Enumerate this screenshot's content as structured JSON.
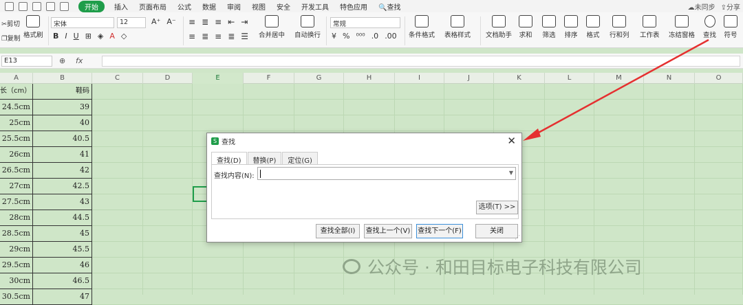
{
  "menubar": {
    "tabs": [
      "开始",
      "插入",
      "页面布局",
      "公式",
      "数据",
      "审阅",
      "视图",
      "安全",
      "开发工具",
      "特色应用"
    ],
    "active_tab": "开始",
    "search": "查找",
    "sync": "未同步",
    "share": "分享"
  },
  "ribbon": {
    "cut": "剪切",
    "copy": "复制",
    "format_painter": "格式刷",
    "font_name": "宋体",
    "font_size": "12",
    "merge_center": "合并居中",
    "wrap_text": "自动换行",
    "number_format": "常规",
    "conditional_format": "条件格式",
    "table_style": "表格样式",
    "doc_assistant": "文档助手",
    "sum": "求和",
    "filter": "筛选",
    "sort": "排序",
    "format": "格式",
    "rows_cols": "行和列",
    "worksheet": "工作表",
    "freeze": "冻结窗格",
    "find": "查找",
    "symbol": "符号"
  },
  "formula_bar": {
    "cell_ref": "E13",
    "fx": "fx"
  },
  "columns": [
    "A",
    "B",
    "C",
    "D",
    "E",
    "F",
    "G",
    "H",
    "I",
    "J",
    "K",
    "L",
    "M",
    "N",
    "O"
  ],
  "sheet": {
    "header": [
      "长（cm）",
      "鞋码"
    ],
    "rows": [
      [
        "24.5cm",
        "39"
      ],
      [
        "25cm",
        "40"
      ],
      [
        "25.5cm",
        "40.5"
      ],
      [
        "26cm",
        "41"
      ],
      [
        "26.5cm",
        "42"
      ],
      [
        "27cm",
        "42.5"
      ],
      [
        "27.5cm",
        "43"
      ],
      [
        "28cm",
        "44.5"
      ],
      [
        "28.5cm",
        "45"
      ],
      [
        "29cm",
        "45.5"
      ],
      [
        "29.5cm",
        "46"
      ],
      [
        "30cm",
        "46.5"
      ],
      [
        "30.5cm",
        "47"
      ]
    ]
  },
  "dialog": {
    "title": "查找",
    "tabs": [
      "查找(D)",
      "替换(P)",
      "定位(G)"
    ],
    "find_label": "查找内容(N):",
    "find_value": "",
    "options": "选项(T) >>",
    "buttons": [
      "查找全部(I)",
      "查找上一个(V)",
      "查找下一个(F)",
      "关闭"
    ]
  },
  "watermark": "公众号 · 和田目标电子科技有限公司",
  "colors": {
    "accent": "#1f9d4a",
    "grid_bg": "#cfe6c8",
    "arrow": "#e53030"
  }
}
